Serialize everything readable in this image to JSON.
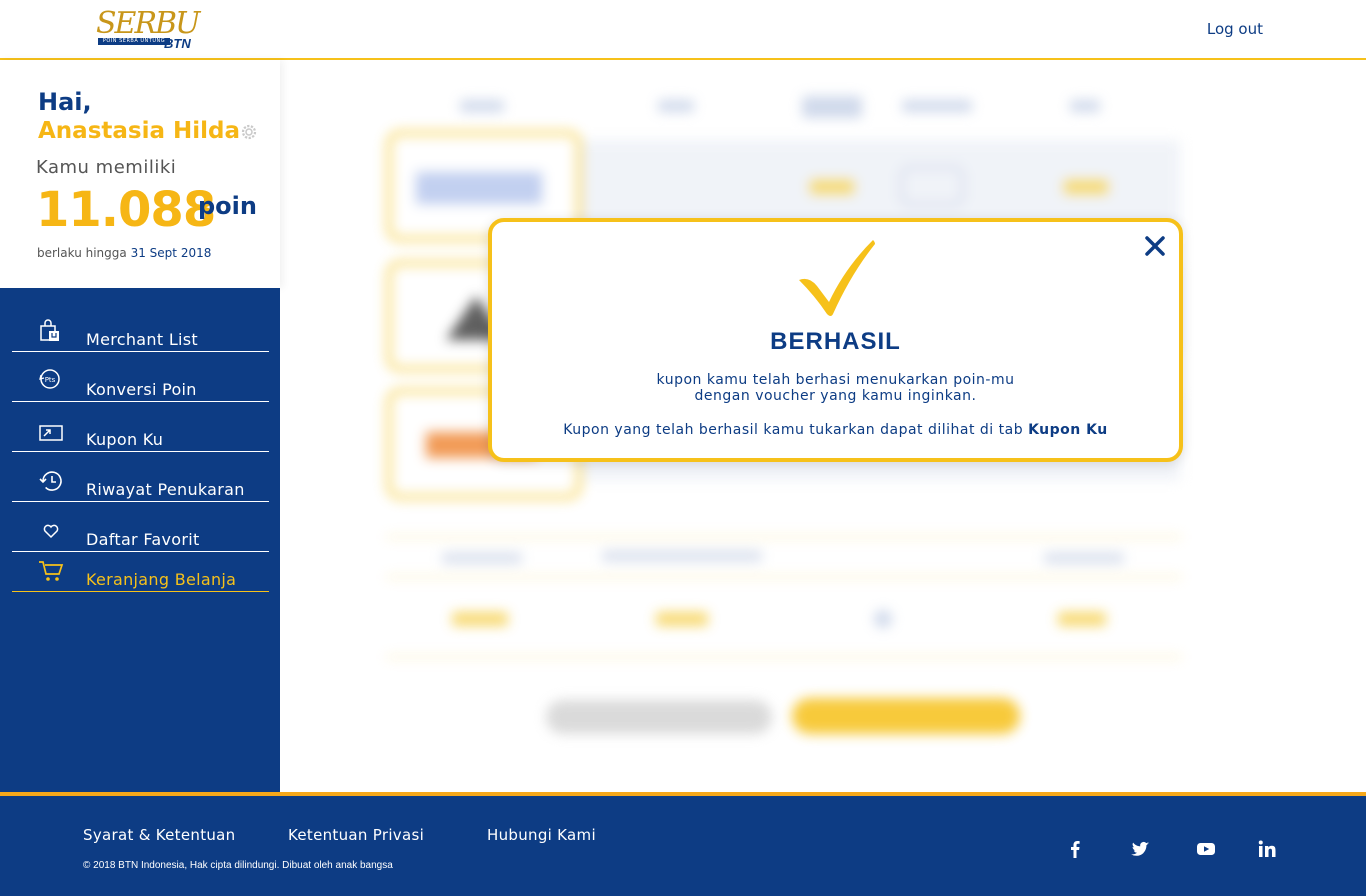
{
  "header": {
    "logo_text": "SERBU",
    "logo_tagline": "POIN SERBA UNTUNG",
    "logo_sub": "BTN",
    "logout_label": "Log out"
  },
  "profile": {
    "greeting": "Hai,",
    "name": "Anastasia Hilda",
    "have_label": "Kamu memiliki",
    "points": "11.088",
    "points_unit": "poin",
    "valid_label": "berlaku hingga",
    "valid_date": "31 Sept 2018"
  },
  "sidebar": {
    "items": [
      {
        "label": "Merchant List",
        "icon": "shopping-bag-icon"
      },
      {
        "label": "Konversi Poin",
        "icon": "points-convert-icon"
      },
      {
        "label": "Kupon Ku",
        "icon": "coupon-icon"
      },
      {
        "label": "Riwayat Penukaran",
        "icon": "history-icon"
      },
      {
        "label": "Daftar Favorit",
        "icon": "heart-icon"
      },
      {
        "label": "Keranjang Belanja",
        "icon": "cart-icon",
        "active": true
      }
    ]
  },
  "modal": {
    "title": "BERHASIL",
    "message_line1": "kupon kamu telah berhasi menukarkan poin-mu",
    "message_line2": "dengan voucher yang kamu inginkan.",
    "message_line3": "Kupon yang telah berhasil kamu tukarkan dapat dilihat di tab",
    "message_link": "Kupon Ku"
  },
  "footer": {
    "links": [
      "Syarat & Ketentuan",
      "Ketentuan Privasi",
      "Hubungi Kami"
    ],
    "copyright": "© 2018 BTN Indonesia, Hak cipta dilindungi. Dibuat oleh anak bangsa",
    "social": [
      "facebook-icon",
      "twitter-icon",
      "youtube-icon",
      "linkedin-icon"
    ]
  },
  "colors": {
    "primary": "#0d3c84",
    "accent": "#f6c11a",
    "footer_border": "#f6a81a"
  }
}
